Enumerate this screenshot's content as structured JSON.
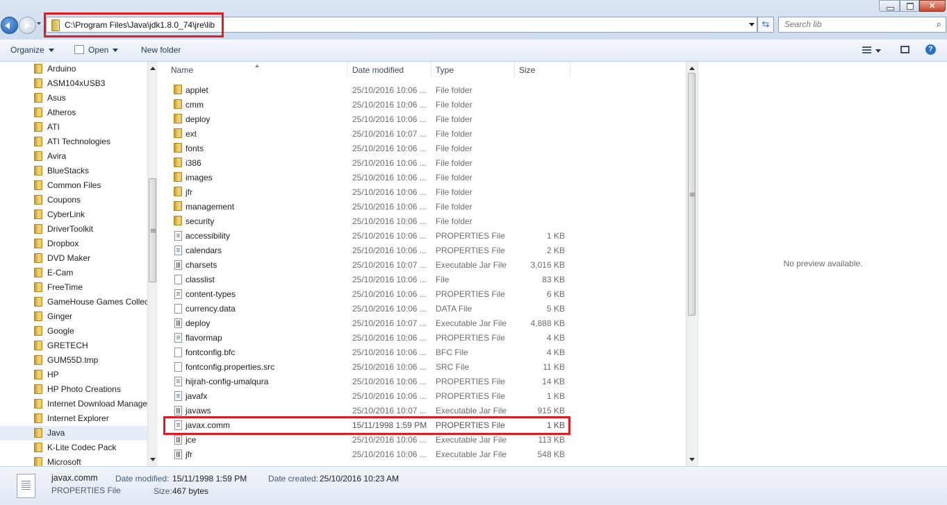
{
  "address": {
    "path": "C:\\Program Files\\Java\\jdk1.8.0_74\\jre\\lib"
  },
  "search": {
    "placeholder": "Search lib"
  },
  "toolbar": {
    "organize": "Organize",
    "open": "Open",
    "new_folder": "New folder"
  },
  "nav": {
    "items": [
      {
        "label": "Arduino"
      },
      {
        "label": "ASM104xUSB3"
      },
      {
        "label": "Asus"
      },
      {
        "label": "Atheros"
      },
      {
        "label": "ATI"
      },
      {
        "label": "ATI Technologies"
      },
      {
        "label": "Avira"
      },
      {
        "label": "BlueStacks"
      },
      {
        "label": "Common Files"
      },
      {
        "label": "Coupons"
      },
      {
        "label": "CyberLink"
      },
      {
        "label": "DriverToolkit"
      },
      {
        "label": "Dropbox"
      },
      {
        "label": "DVD Maker"
      },
      {
        "label": "E-Cam"
      },
      {
        "label": "FreeTime"
      },
      {
        "label": "GameHouse Games Collection"
      },
      {
        "label": "Ginger"
      },
      {
        "label": "Google"
      },
      {
        "label": "GRETECH"
      },
      {
        "label": "GUM55D.tmp"
      },
      {
        "label": "HP"
      },
      {
        "label": "HP Photo Creations"
      },
      {
        "label": "Internet Download Manager"
      },
      {
        "label": "Internet Explorer"
      },
      {
        "label": "Java",
        "selected": true
      },
      {
        "label": "K-Lite Codec Pack"
      },
      {
        "label": "Microsoft"
      }
    ]
  },
  "columns": {
    "name": "Name",
    "date": "Date modified",
    "type": "Type",
    "size": "Size"
  },
  "files": [
    {
      "name": "applet",
      "date": "25/10/2016 10:06 ...",
      "type": "File folder",
      "size": "",
      "icon": "folder"
    },
    {
      "name": "cmm",
      "date": "25/10/2016 10:06 ...",
      "type": "File folder",
      "size": "",
      "icon": "folder"
    },
    {
      "name": "deploy",
      "date": "25/10/2016 10:06 ...",
      "type": "File folder",
      "size": "",
      "icon": "folder"
    },
    {
      "name": "ext",
      "date": "25/10/2016 10:07 ...",
      "type": "File folder",
      "size": "",
      "icon": "folder"
    },
    {
      "name": "fonts",
      "date": "25/10/2016 10:06 ...",
      "type": "File folder",
      "size": "",
      "icon": "folder"
    },
    {
      "name": "i386",
      "date": "25/10/2016 10:06 ...",
      "type": "File folder",
      "size": "",
      "icon": "folder"
    },
    {
      "name": "images",
      "date": "25/10/2016 10:06 ...",
      "type": "File folder",
      "size": "",
      "icon": "folder"
    },
    {
      "name": "jfr",
      "date": "25/10/2016 10:06 ...",
      "type": "File folder",
      "size": "",
      "icon": "folder"
    },
    {
      "name": "management",
      "date": "25/10/2016 10:06 ...",
      "type": "File folder",
      "size": "",
      "icon": "folder"
    },
    {
      "name": "security",
      "date": "25/10/2016 10:06 ...",
      "type": "File folder",
      "size": "",
      "icon": "folder"
    },
    {
      "name": "accessibility",
      "date": "25/10/2016 10:06 ...",
      "type": "PROPERTIES File",
      "size": "1 KB",
      "icon": "props"
    },
    {
      "name": "calendars",
      "date": "25/10/2016 10:06 ...",
      "type": "PROPERTIES File",
      "size": "2 KB",
      "icon": "props"
    },
    {
      "name": "charsets",
      "date": "25/10/2016 10:07 ...",
      "type": "Executable Jar File",
      "size": "3,016 KB",
      "icon": "jar"
    },
    {
      "name": "classlist",
      "date": "25/10/2016 10:06 ...",
      "type": "File",
      "size": "83 KB",
      "icon": "file"
    },
    {
      "name": "content-types",
      "date": "25/10/2016 10:06 ...",
      "type": "PROPERTIES File",
      "size": "6 KB",
      "icon": "props"
    },
    {
      "name": "currency.data",
      "date": "25/10/2016 10:06 ...",
      "type": "DATA File",
      "size": "5 KB",
      "icon": "file"
    },
    {
      "name": "deploy",
      "date": "25/10/2016 10:07 ...",
      "type": "Executable Jar File",
      "size": "4,888 KB",
      "icon": "jar"
    },
    {
      "name": "flavormap",
      "date": "25/10/2016 10:06 ...",
      "type": "PROPERTIES File",
      "size": "4 KB",
      "icon": "props"
    },
    {
      "name": "fontconfig.bfc",
      "date": "25/10/2016 10:06 ...",
      "type": "BFC File",
      "size": "4 KB",
      "icon": "file"
    },
    {
      "name": "fontconfig.properties.src",
      "date": "25/10/2016 10:06 ...",
      "type": "SRC File",
      "size": "11 KB",
      "icon": "file"
    },
    {
      "name": "hijrah-config-umalqura",
      "date": "25/10/2016 10:06 ...",
      "type": "PROPERTIES File",
      "size": "14 KB",
      "icon": "props"
    },
    {
      "name": "javafx",
      "date": "25/10/2016 10:06 ...",
      "type": "PROPERTIES File",
      "size": "1 KB",
      "icon": "props"
    },
    {
      "name": "javaws",
      "date": "25/10/2016 10:07 ...",
      "type": "Executable Jar File",
      "size": "915 KB",
      "icon": "jar"
    },
    {
      "name": "javax.comm",
      "date": "15/11/1998 1:59 PM",
      "type": "PROPERTIES File",
      "size": "1 KB",
      "icon": "props",
      "selected": true
    },
    {
      "name": "jce",
      "date": "25/10/2016 10:06 ...",
      "type": "Executable Jar File",
      "size": "113 KB",
      "icon": "jar"
    },
    {
      "name": "jfr",
      "date": "25/10/2016 10:06 ...",
      "type": "Executable Jar File",
      "size": "548 KB",
      "icon": "jar"
    }
  ],
  "preview": {
    "text": "No preview available."
  },
  "details": {
    "name": "javax.comm",
    "type": "PROPERTIES File",
    "modified_label": "Date modified:",
    "modified_value": "15/11/1998 1:59 PM",
    "size_label": "Size:",
    "size_value": "467 bytes",
    "created_label": "Date created:",
    "created_value": "25/10/2016 10:23 AM"
  }
}
